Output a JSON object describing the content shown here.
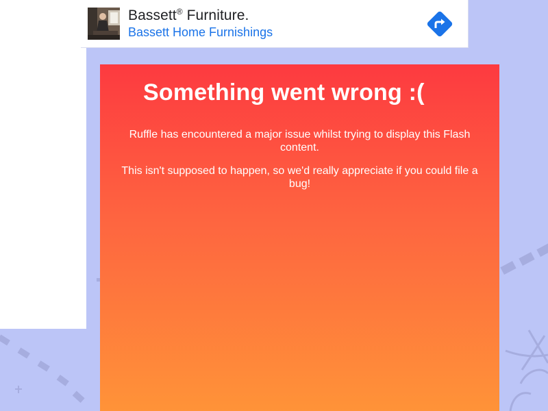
{
  "ad": {
    "title": "Bassett",
    "title_mark": "®",
    "title_suffix": " Furniture.",
    "subtitle": "Bassett Home Furnishings",
    "thumbnail_icon": "furniture-photo",
    "action_icon": "directions-arrow-icon",
    "action_color": "#1a73e8"
  },
  "error": {
    "title": "Something went wrong :(",
    "message_1": "Ruffle has encountered a major issue whilst trying to display this Flash content.",
    "message_2": "This isn't supposed to happen, so we'd really appreciate if you could file a bug!",
    "gradient_top": "#fd3a40",
    "gradient_bottom": "#ff9338"
  },
  "colors": {
    "background": "#bcc5f7",
    "decoration": "#9ea6de"
  }
}
